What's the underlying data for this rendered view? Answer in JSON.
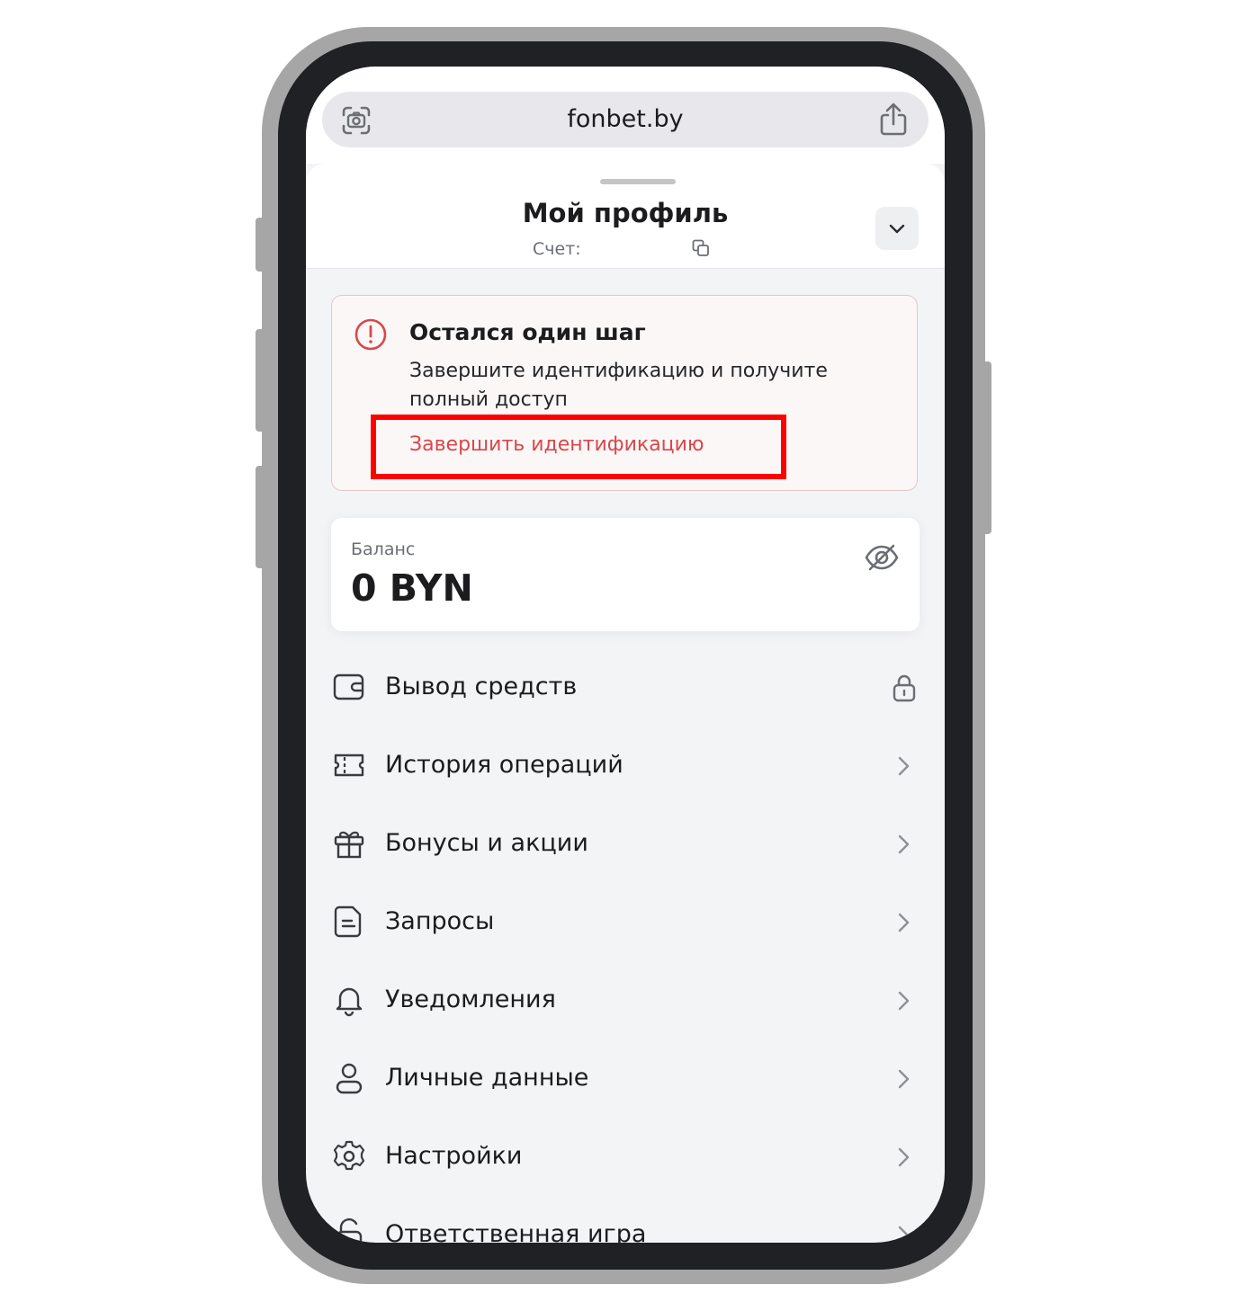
{
  "browser": {
    "url": "fonbet.by",
    "lens_icon": "visual-search-icon",
    "share_icon": "share-icon"
  },
  "profile": {
    "title": "Мой профиль",
    "account_label": "Счет:",
    "copy_icon": "copy-icon",
    "collapse_icon": "chevron-down-icon"
  },
  "alert": {
    "icon": "exclamation-circle-icon",
    "title": "Остался один шаг",
    "text": "Завершите идентификацию и получите полный доступ",
    "link": "Завершить идентификацию",
    "colors": {
      "accent": "#d9474b",
      "highlight": "#ff0000",
      "background": "#fbf7f7"
    }
  },
  "balance": {
    "label": "Баланс",
    "value": "0 BYN",
    "visibility_icon": "eye-off-icon"
  },
  "menu": [
    {
      "label": "Вывод средств",
      "icon": "wallet-icon",
      "trailing": "lock-icon"
    },
    {
      "label": "История операций",
      "icon": "ticket-icon",
      "trailing": "chevron-right-icon"
    },
    {
      "label": "Бонусы и акции",
      "icon": "gift-icon",
      "trailing": "chevron-right-icon"
    },
    {
      "label": "Запросы",
      "icon": "document-icon",
      "trailing": "chevron-right-icon"
    },
    {
      "label": "Уведомления",
      "icon": "bell-icon",
      "trailing": "chevron-right-icon"
    },
    {
      "label": "Личные данные",
      "icon": "user-icon",
      "trailing": "chevron-right-icon"
    },
    {
      "label": "Настройки",
      "icon": "gear-icon",
      "trailing": "chevron-right-icon"
    },
    {
      "label": "Ответственная игра",
      "icon": "shield-lock-icon",
      "trailing": "chevron-right-icon"
    }
  ]
}
